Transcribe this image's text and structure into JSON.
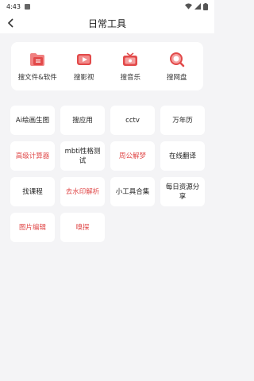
{
  "status_bar": {
    "time": "4:43"
  },
  "header": {
    "title": "日常工具"
  },
  "categories": [
    {
      "label": "搜文件&软件",
      "icon": "folder-file-icon"
    },
    {
      "label": "搜影视",
      "icon": "video-play-icon"
    },
    {
      "label": "搜音乐",
      "icon": "tv-music-icon"
    },
    {
      "label": "搜网盘",
      "icon": "magnifier-icon"
    }
  ],
  "tools": [
    {
      "label": "Ai绘画生图",
      "highlight": false
    },
    {
      "label": "搜应用",
      "highlight": false
    },
    {
      "label": "cctv",
      "highlight": false
    },
    {
      "label": "万年历",
      "highlight": false
    },
    {
      "label": "高级计算器",
      "highlight": true
    },
    {
      "label": "mbti性格测试",
      "highlight": false
    },
    {
      "label": "周公解梦",
      "highlight": true
    },
    {
      "label": "在线翻译",
      "highlight": false
    },
    {
      "label": "找课程",
      "highlight": false
    },
    {
      "label": "去水印解析",
      "highlight": true
    },
    {
      "label": "小工具合集",
      "highlight": false
    },
    {
      "label": "每日资源分享",
      "highlight": false
    },
    {
      "label": "图片编辑",
      "highlight": true
    },
    {
      "label": "嗅探",
      "highlight": true
    }
  ],
  "colors": {
    "accent": "#e04848",
    "background": "#f4f4f6",
    "card": "#ffffff"
  }
}
